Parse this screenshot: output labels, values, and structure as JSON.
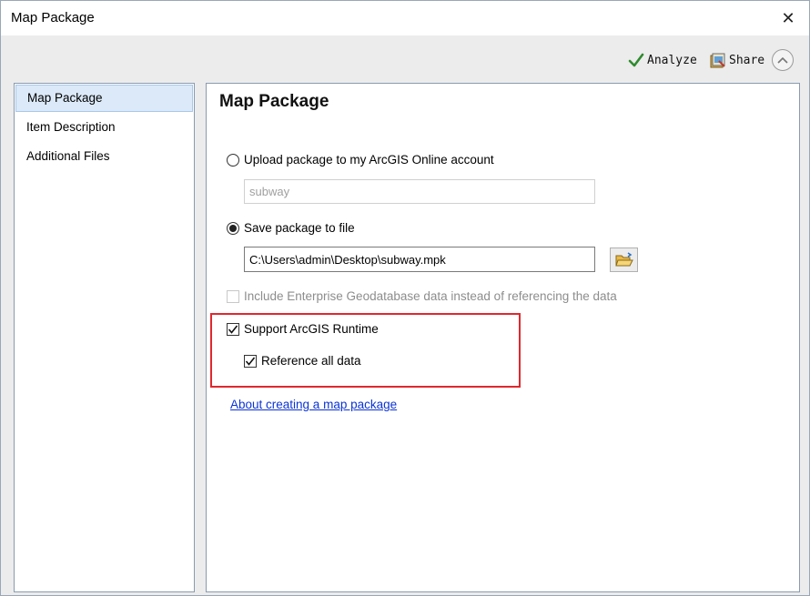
{
  "window": {
    "title": "Map Package"
  },
  "toolbar": {
    "analyze_label": "Analyze",
    "share_label": "Share"
  },
  "sidebar": {
    "items": [
      {
        "label": "Map Package",
        "active": true
      },
      {
        "label": "Item Description",
        "active": false
      },
      {
        "label": "Additional Files",
        "active": false
      }
    ]
  },
  "main": {
    "heading": "Map Package",
    "upload_option": {
      "label": "Upload package to my ArcGIS Online account",
      "selected": false
    },
    "upload_name_value": "subway",
    "save_option": {
      "label": "Save package to file",
      "selected": true
    },
    "save_path_value": "C:\\Users\\admin\\Desktop\\subway.mpk",
    "enterprise_option": {
      "label": "Include Enterprise Geodatabase data instead of referencing the data",
      "checked": false,
      "enabled": false
    },
    "runtime_option": {
      "label": "Support ArcGIS Runtime",
      "checked": true
    },
    "reference_option": {
      "label": "Reference all data",
      "checked": true
    },
    "help_link": "About creating a map package"
  },
  "colors": {
    "highlight_border": "#e0282e",
    "link": "#0b33d6",
    "selection_bg": "#dbe9f8"
  }
}
